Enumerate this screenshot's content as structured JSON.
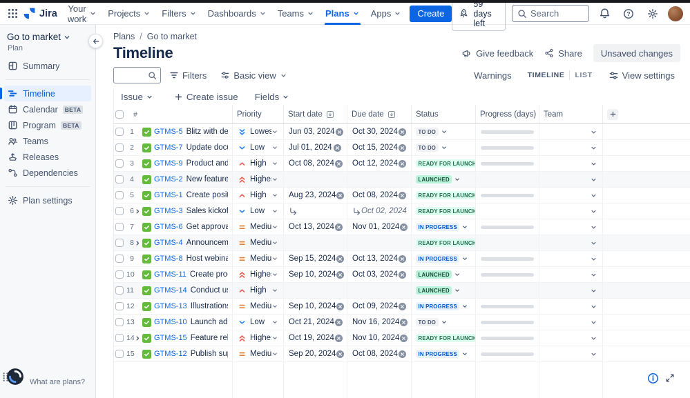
{
  "colors": {
    "accent": "#0C66E4",
    "sidebar_bg": "#F7F8F9",
    "selected_item": "#E7F0FE"
  },
  "nav": {
    "app_name": "Jira",
    "items": [
      {
        "label": "Your work"
      },
      {
        "label": "Projects"
      },
      {
        "label": "Filters"
      },
      {
        "label": "Dashboards"
      },
      {
        "label": "Teams"
      },
      {
        "label": "Plans",
        "active": true
      },
      {
        "label": "Apps"
      }
    ],
    "create_label": "Create",
    "trial_label": "59 days left",
    "search_placeholder": "Search"
  },
  "sidebar": {
    "plan_switcher": "Go to market",
    "plan_type_label": "Plan",
    "items": [
      {
        "label": "Summary",
        "icon": "summary-icon"
      },
      {
        "label": "Timeline",
        "icon": "timeline-icon",
        "active": true
      },
      {
        "label": "Calendar",
        "icon": "calendar-icon",
        "badge": "BETA"
      },
      {
        "label": "Program",
        "icon": "program-icon",
        "badge": "BETA"
      },
      {
        "label": "Teams",
        "icon": "teams-icon"
      },
      {
        "label": "Releases",
        "icon": "releases-icon"
      },
      {
        "label": "Dependencies",
        "icon": "dependencies-icon"
      }
    ],
    "settings_label": "Plan settings"
  },
  "page": {
    "breadcrumbs": [
      "Plans",
      "Go to market"
    ],
    "title": "Timeline",
    "actions": {
      "feedback": "Give feedback",
      "share": "Share",
      "unsaved": "Unsaved changes"
    }
  },
  "toolbar": {
    "search_value": "",
    "filters_label": "Filters",
    "view_select": "Basic view",
    "warnings_label": "Warnings",
    "mode_timeline": "TIMELINE",
    "mode_list": "LIST",
    "view_settings_label": "View settings"
  },
  "status_styles": {
    "todo": {
      "bg": "#F1F2F4",
      "fg": "#44546F"
    },
    "inprogress": {
      "bg": "#E9F2FF",
      "fg": "#0055CC"
    },
    "ready": {
      "bg": "#DCFFF1",
      "fg": "#216E4E"
    },
    "launched": {
      "bg": "#BAF3DB",
      "fg": "#164B35"
    }
  },
  "priority_colors": {
    "Lowest": "#2684FF",
    "Low": "#2684FF",
    "Medium": "#E97F33",
    "High": "#F15B50",
    "Highest": "#F15B50"
  },
  "table": {
    "issue_header": "Issue",
    "create_issue_label": "Create issue",
    "fields_label": "Fields",
    "columns": {
      "num": "#",
      "priority": "Priority",
      "start": "Start date",
      "due": "Due date",
      "status": "Status",
      "progress": "Progress (days)",
      "team": "Team"
    },
    "rows": [
      {
        "num": 1,
        "key": "GTMS-5",
        "summary": "Blitz with dev team",
        "priority": "Lowest",
        "start": "Jun 03, 2024",
        "due": "Oct 30, 2024",
        "status": "TO DO",
        "status_kind": "todo",
        "progress_bar": true
      },
      {
        "num": 2,
        "key": "GTMS-7",
        "summary": "Update documenta...",
        "priority": "Low",
        "start": "Jul 01, 2024",
        "due": "Oct 15, 2024",
        "status": "TO DO",
        "status_kind": "todo",
        "progress_bar": true
      },
      {
        "num": 3,
        "key": "GTMS-9",
        "summary": "Product and Mar...",
        "priority": "High",
        "start": "Oct 08, 2024",
        "due": "Oct 12, 2024",
        "status": "READY FOR LAUNCH",
        "status_kind": "ready",
        "progress_bar": true
      },
      {
        "num": 4,
        "key": "GTMS-2",
        "summary": "New feature nami...",
        "priority": "Highest",
        "start": "",
        "due": "",
        "status": "LAUNCHED",
        "status_kind": "launched",
        "progress_bar": false,
        "shaded": true
      },
      {
        "num": 5,
        "key": "GTMS-1",
        "summary": "Create positionin...",
        "priority": "High",
        "start": "Aug 23, 2024",
        "due": "Oct 08, 2024",
        "status": "READY FOR LAUNCH",
        "status_kind": "ready",
        "progress_bar": true
      },
      {
        "num": 6,
        "key": "GTMS-3",
        "summary": "Sales kickoff",
        "priority": "Low",
        "start": "",
        "due": "",
        "status": "READY FOR LAUNCH",
        "status_kind": "ready",
        "progress_bar": false,
        "expandable": true,
        "start_rollup": true,
        "due_rollup": true,
        "due_rollup_value": "Oct 02, 2024"
      },
      {
        "num": 7,
        "key": "GTMS-6",
        "summary": "Get approvals on ...",
        "priority": "Medium",
        "start": "Oct 13, 2024",
        "due": "Nov 01, 2024",
        "status": "IN PROGRESS",
        "status_kind": "inprogress",
        "progress_bar": true
      },
      {
        "num": 8,
        "key": "GTMS-4",
        "summary": "Announcement b...",
        "priority": "Medium",
        "start": "",
        "due": "",
        "status": "READY FOR LAUNCH",
        "status_kind": "ready",
        "progress_bar": false,
        "expandable": true,
        "shaded": true
      },
      {
        "num": 9,
        "key": "GTMS-8",
        "summary": "Host webinar",
        "priority": "Medium",
        "start": "Sep 15, 2024",
        "due": "Oct 13, 2024",
        "status": "IN PROGRESS",
        "status_kind": "inprogress",
        "progress_bar": true
      },
      {
        "num": 10,
        "key": "GTMS-11",
        "summary": "Create product ...",
        "priority": "Highest",
        "start": "Sep 10, 2024",
        "due": "Oct 03, 2024",
        "status": "LAUNCHED",
        "status_kind": "launched",
        "progress_bar": true
      },
      {
        "num": 11,
        "key": "GTMS-14",
        "summary": "Conduct user in...",
        "priority": "High",
        "start": "",
        "due": "",
        "status": "LAUNCHED",
        "status_kind": "launched",
        "progress_bar": false,
        "shaded": true
      },
      {
        "num": 12,
        "key": "GTMS-13",
        "summary": "Illustrations for ...",
        "priority": "Medium",
        "start": "Sep 10, 2024",
        "due": "Oct 09, 2024",
        "status": "IN PROGRESS",
        "status_kind": "inprogress",
        "progress_bar": true
      },
      {
        "num": 13,
        "key": "GTMS-10",
        "summary": "Launch ad camp...",
        "priority": "Low",
        "start": "Oct 21, 2024",
        "due": "Nov 16, 2024",
        "status": "TO DO",
        "status_kind": "todo",
        "progress_bar": true
      },
      {
        "num": 14,
        "key": "GTMS-15",
        "summary": "Feature release ...",
        "priority": "Highest",
        "start": "Oct 19, 2024",
        "due": "Nov 10, 2024",
        "status": "READY FOR LAUNCH",
        "status_kind": "ready",
        "progress_bar": true,
        "expandable": true
      },
      {
        "num": 15,
        "key": "GTMS-12",
        "summary": "Publish support ...",
        "priority": "Medium",
        "start": "Sep 20, 2024",
        "due": "Oct 08, 2024",
        "status": "IN PROGRESS",
        "status_kind": "inprogress",
        "progress_bar": true
      }
    ]
  },
  "floating": {
    "whats_plans_label": "What are plans?"
  }
}
